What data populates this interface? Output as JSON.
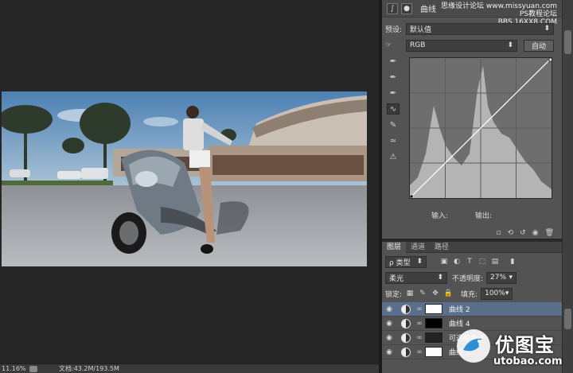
{
  "canvas": {
    "photo_alt": "",
    "zoom": "11.16%",
    "doc_info": "文档:43.2M/193.5M"
  },
  "properties": {
    "title": "曲线",
    "watermark_line1": "思缘设计论坛 www.missyuan.com",
    "watermark_line2": "PS教程论坛",
    "watermark_line3": "BBS.16XX8.COM",
    "preset_label": "预设:",
    "preset_value": "默认值",
    "channel_value": "RGB",
    "auto_button": "自动",
    "input_label": "输入:",
    "output_label": "输出:"
  },
  "layers": {
    "tabs": [
      "图层",
      "通道",
      "路径"
    ],
    "filter_value": "ρ 类型",
    "blend_mode": "柔光",
    "opacity_label": "不透明度:",
    "opacity_value": "27%",
    "lock_label": "锁定:",
    "fill_label": "填充:",
    "fill_value": "100%",
    "items": [
      {
        "name": "曲线 2",
        "selected": true
      },
      {
        "name": "曲线 4",
        "selected": false
      },
      {
        "name": "可选颜色 2",
        "selected": false
      },
      {
        "name": "曲线 3",
        "selected": false
      }
    ]
  },
  "logo": {
    "brand": "优图宝",
    "domain": "utobao.com"
  },
  "colors": {
    "panel_bg": "#535353",
    "selection": "#5a6f8c",
    "sky": "#6f9cc4"
  }
}
